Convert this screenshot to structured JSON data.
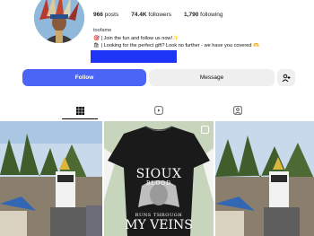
{
  "profile": {
    "stats": {
      "posts_count": "966",
      "posts_label": "posts",
      "followers_count": "74.4K",
      "followers_label": "followers",
      "following_count": "1,790",
      "following_label": "following"
    },
    "bio": {
      "username": "toofame",
      "line1": "🎯 | Join the fun and follow us now!✨",
      "line2": "🛍 | Looking for the perfect gift? Look no further - we have you covered 🫶"
    }
  },
  "actions": {
    "follow_label": "Follow",
    "message_label": "Message"
  },
  "tabs": [
    {
      "icon": "grid-icon",
      "active": true
    },
    {
      "icon": "reels-icon",
      "active": false
    },
    {
      "icon": "tagged-icon",
      "active": false
    }
  ],
  "posts": {
    "shirt": {
      "line1": "SIOUX",
      "line2": "BLOOD",
      "line3": "RUNS THROUGH",
      "line4": "MY VEINS"
    }
  },
  "colors": {
    "accent": "#4b65f6",
    "link_bar": "#1d33f5",
    "secondary_button": "#efefef"
  }
}
